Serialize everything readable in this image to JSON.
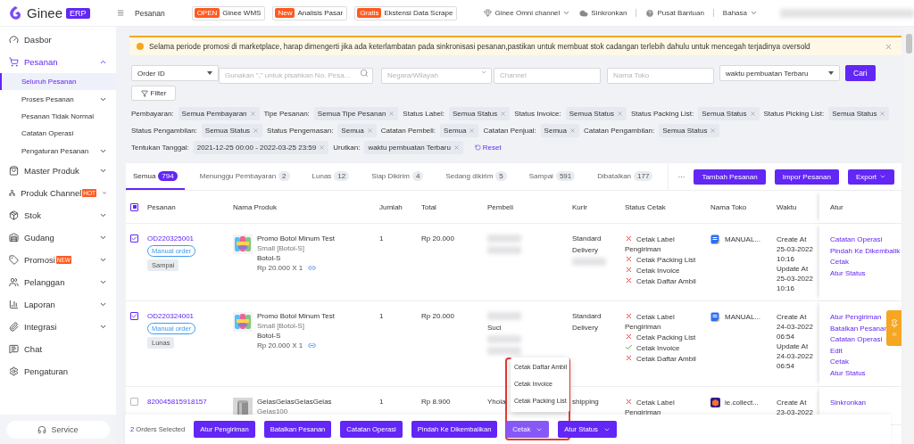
{
  "brand": {
    "name": "Ginee",
    "badge": "ERP"
  },
  "top_bar": {
    "page": "Pesanan",
    "promos": [
      {
        "tag": "OPEN",
        "label": "Ginee WMS"
      },
      {
        "tag": "New",
        "label": "Analisis Pasar"
      },
      {
        "tag": "Gratis",
        "label": "Ekstensi Data Scrape"
      }
    ],
    "links": [
      {
        "kind": "channel",
        "label": "Ginee Omni channel"
      },
      {
        "kind": "sync",
        "label": "Sinkronkan"
      },
      {
        "kind": "help",
        "label": "Pusat Bantuan"
      },
      {
        "kind": "language",
        "label": "Bahasa"
      }
    ]
  },
  "sidebar": {
    "items": [
      {
        "label": "Dasbor"
      },
      {
        "label": "Pesanan",
        "expanded": true,
        "children": [
          {
            "label": "Seluruh Pesanan",
            "selected": true
          },
          {
            "label": "Proses Pesanan",
            "selected": false,
            "expanded": false
          },
          {
            "label": "Pesanan Tidak Normal",
            "selected": false
          },
          {
            "label": "Catatan Operasi",
            "selected": false
          },
          {
            "label": "Pengaturan Pesanan",
            "selected": false,
            "expanded": false
          }
        ]
      },
      {
        "label": "Master Produk",
        "expanded": false
      },
      {
        "label": "Produk Channel",
        "badge": "HOT",
        "expanded": false
      },
      {
        "label": "Stok",
        "expanded": false
      },
      {
        "label": "Gudang",
        "expanded": false
      },
      {
        "label": "Promosi",
        "badge": "NEW",
        "expanded": false
      },
      {
        "label": "Pelanggan",
        "expanded": false
      },
      {
        "label": "Laporan",
        "expanded": false
      },
      {
        "label": "Integrasi",
        "expanded": false
      },
      {
        "label": "Chat"
      },
      {
        "label": "Pengaturan"
      }
    ],
    "service": "Service"
  },
  "alert": {
    "message": "Selama periode promosi di marketplace, harap dimengerti jika ada keterlambatan pada sinkronisasi pesanan,pastikan untuk membuat stok cadangan terlebih dahulu untuk mencegah terjadinya oversold"
  },
  "search": {
    "field_select": "Order ID",
    "order_placeholder": "Gunakan \",\" untuk pisahkan No. Pesa...",
    "region_placeholder": "Negara/Wilayah",
    "channel_placeholder": "Channel",
    "store_placeholder": "Nama Toko",
    "sort_select": "waktu pembuatan Terbaru",
    "button": "Cari"
  },
  "filter_button": "Filter",
  "active_filters": [
    {
      "label": "Pembayaran:",
      "value": "Semua Pembayaran"
    },
    {
      "label": "Tipe Pesanan:",
      "value": "Semua Tipe Pesanan"
    },
    {
      "label": "Status Label:",
      "value": "Semua Status"
    },
    {
      "label": "Status Invoice:",
      "value": "Semua Status"
    },
    {
      "label": "Status Packing List:",
      "value": "Semua Status"
    },
    {
      "label": "Status Picking List:",
      "value": "Semua Status"
    },
    {
      "label": "Status Pengambilan:",
      "value": "Semua Status"
    },
    {
      "label": "Status Pengemasan:",
      "value": "Semua"
    },
    {
      "label": "Catatan Pembeli:",
      "value": "Semua"
    },
    {
      "label": "Catatan Penjual:",
      "value": "Semua"
    },
    {
      "label": "Catatan Pengambilan:",
      "value": "Semua Status"
    },
    {
      "label": "Tentukan Tanggal:",
      "value": "2021-12-25 00:00 - 2022-03-25 23:59"
    },
    {
      "label": "Urutkan:",
      "value": "waktu pembuatan Terbaru"
    }
  ],
  "reset": "Reset",
  "tabs": [
    {
      "label": "Semua",
      "count": "794",
      "selected": true
    },
    {
      "label": "Menunggu Pembayaran",
      "count": "2",
      "selected": false
    },
    {
      "label": "Lunas",
      "count": "12",
      "selected": false
    },
    {
      "label": "Siap Dikirim",
      "count": "4",
      "selected": false
    },
    {
      "label": "Sedang dikirim",
      "count": "5",
      "selected": false
    },
    {
      "label": "Sampai",
      "count": "591",
      "selected": false
    },
    {
      "label": "Dibatalkan",
      "count": "177",
      "selected": false
    }
  ],
  "toolbar": {
    "more": "···",
    "buttons": [
      {
        "label": "Tambah Pesanan",
        "kind": "plain"
      },
      {
        "label": "Impor Pesanan",
        "kind": "plain"
      },
      {
        "label": "Export",
        "kind": "menu"
      }
    ]
  },
  "table": {
    "select_all": {
      "indeterminate": true
    },
    "columns": [
      "Pesanan",
      "Nama Produk",
      "Jumlah",
      "Total",
      "Pembeli",
      "Kurir",
      "Status Cetak",
      "Nama Toko",
      "Waktu",
      "Atur"
    ],
    "rows": [
      {
        "selected": true,
        "order_id": "OD220325001",
        "tags": [
          {
            "kind": "outline",
            "label": "Manual order"
          },
          {
            "kind": "status",
            "label": "Sampai"
          }
        ],
        "product": {
          "name": "Promo Botol Minum Test",
          "variant": "Small [Botol-S]",
          "sku": "Botol-S",
          "price": "Rp 20.000 X 1"
        },
        "quantity": "1",
        "total": "Rp 20.000",
        "buyer": [
          {
            "kind": "redacted"
          },
          {
            "kind": "redacted"
          }
        ],
        "courier": [
          {
            "kind": "text",
            "text": "Standard"
          },
          {
            "kind": "text",
            "text": "Delivery"
          },
          {
            "kind": "redacted"
          }
        ],
        "print_status": [
          {
            "label": "Cetak Label Pengiriman",
            "done": false
          },
          {
            "label": "Cetak Packing List",
            "done": false
          },
          {
            "label": "Cetak Invoice",
            "done": false
          },
          {
            "label": "Cetak Daftar Ambil",
            "done": false
          }
        ],
        "store": {
          "kind": "manual",
          "name": "MANUAL..."
        },
        "time": [
          "Create At",
          "25-03-2022",
          "10:16",
          "Update At",
          "25-03-2022",
          "10:16"
        ],
        "actions": [
          "Catatan Operasi",
          "Pindah Ke Dikembalik",
          "Cetak",
          "Atur Status"
        ]
      },
      {
        "selected": true,
        "order_id": "OD220324001",
        "tags": [
          {
            "kind": "outline",
            "label": "Manual order"
          },
          {
            "kind": "status",
            "label": "Lunas"
          }
        ],
        "product": {
          "name": "Promo Botol Minum Test",
          "variant": "Small [Botol-S]",
          "sku": "Botol-S",
          "price": "Rp 20.000 X 1"
        },
        "quantity": "1",
        "total": "Rp 20.000",
        "buyer": [
          {
            "kind": "redacted"
          },
          {
            "kind": "text",
            "text": "Suci"
          },
          {
            "kind": "redacted"
          },
          {
            "kind": "redacted"
          }
        ],
        "courier": [
          {
            "kind": "text",
            "text": "Standard"
          },
          {
            "kind": "text",
            "text": "Delivery"
          }
        ],
        "print_status": [
          {
            "label": "Cetak Label Pengiriman",
            "done": false
          },
          {
            "label": "Cetak Packing List",
            "done": false
          },
          {
            "label": "Cetak Invoice",
            "done": true
          },
          {
            "label": "Cetak Daftar Ambil",
            "done": false
          }
        ],
        "store": {
          "kind": "manual",
          "name": "MANUAL..."
        },
        "time": [
          "Create At",
          "24-03-2022",
          "06:54",
          "Update At",
          "24-03-2022",
          "06:54"
        ],
        "actions": [
          "Atur Pengiriman",
          "Batalkan Pesanan",
          "Catatan Operasi",
          "Edit",
          "Cetak",
          "Atur Status"
        ]
      },
      {
        "selected": false,
        "order_id": "820045815918157",
        "product": {
          "name": "GelasGelasGelasGelas",
          "variant": "Gelas100"
        },
        "quantity": "1",
        "total": "Rp 8.900",
        "buyer": [
          {
            "kind": "text",
            "text": "Yhola"
          }
        ],
        "courier": [
          {
            "kind": "text",
            "text": "shipping"
          }
        ],
        "print_status": [
          {
            "label": "Cetak Label Pengiriman",
            "done": false
          }
        ],
        "store": {
          "kind": "marketplace",
          "name": "ie.collect..."
        },
        "time": [
          "Create At",
          "23-03-2022"
        ],
        "actions": [
          "Sinkronkan"
        ]
      }
    ]
  },
  "bottom_bar": {
    "count": "2",
    "label": "Orders Selected",
    "buttons": [
      {
        "label": "Atur Pengiriman",
        "kind": "plain"
      },
      {
        "label": "Batalkan Pesanan",
        "kind": "plain"
      },
      {
        "label": "Catatan Operasi",
        "kind": "plain"
      },
      {
        "label": "Pindah Ke Dikembalikan",
        "kind": "plain"
      },
      {
        "label": "Cetak",
        "kind": "menu",
        "open": true,
        "menu": [
          "Cetak Daftar Ambil",
          "Cetak Invoice",
          "Cetak Packing List"
        ]
      },
      {
        "label": "Atur Status",
        "kind": "menu",
        "open": false
      }
    ]
  }
}
